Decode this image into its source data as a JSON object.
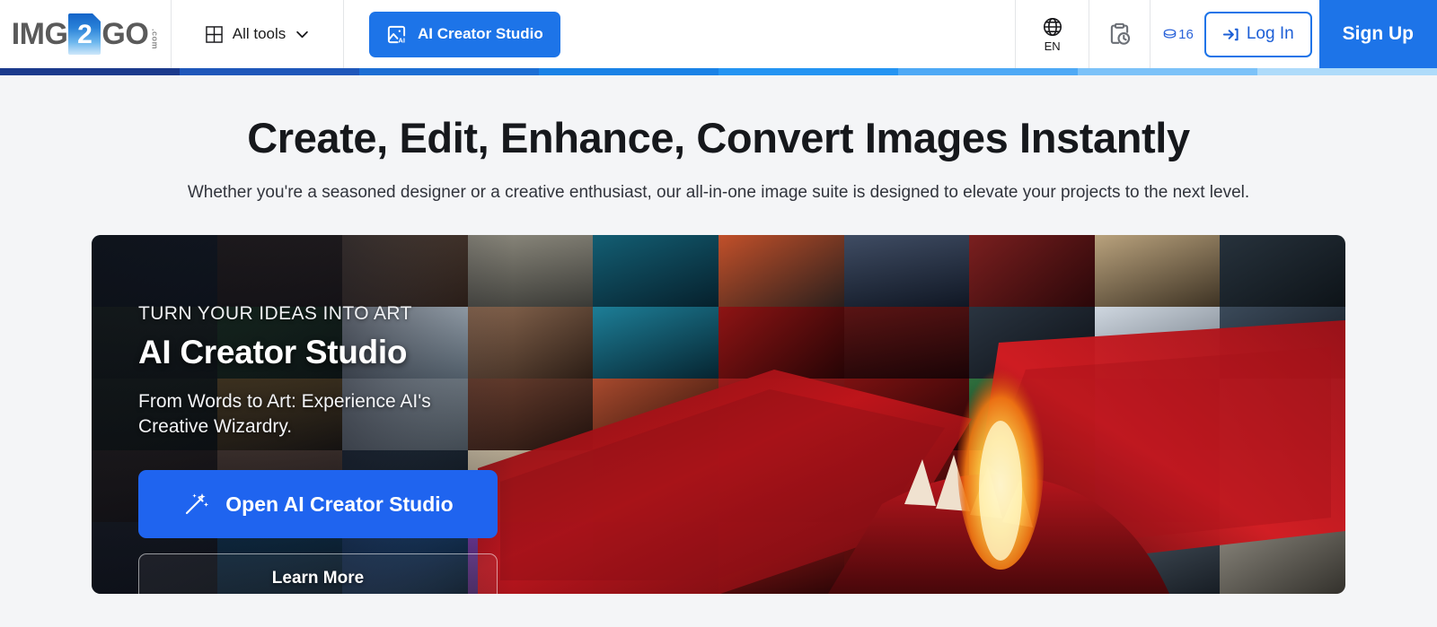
{
  "header": {
    "logo": {
      "left_text": "IMG",
      "badge_text": "2",
      "right_text": "GO",
      "tld_text": ".com"
    },
    "all_tools_label": "All tools",
    "ai_studio_button_label": "AI Creator Studio",
    "language_code": "EN",
    "credits_count": "16",
    "login_label": "Log In",
    "signup_label": "Sign Up",
    "icons": {
      "grid": "grid-icon",
      "chevron": "chevron-down-icon",
      "ai_image": "ai-image-icon",
      "globe": "globe-icon",
      "history": "clipboard-clock-icon",
      "coin": "credit-coin-icon",
      "login_arrow": "login-arrow-icon"
    },
    "accent_color": "#1d74e8",
    "gradient_strip": [
      "#1b3a8c",
      "#1f57ba",
      "#1c6ed4",
      "#1a82e6",
      "#2494f2",
      "#4ea9f5",
      "#7cc2f8",
      "#aedbfa"
    ]
  },
  "hero": {
    "title": "Create, Edit, Enhance, Convert Images Instantly",
    "subtitle": "Whether you're a seasoned designer or a creative enthusiast, our all-in-one image suite is designed to elevate your projects to the next level."
  },
  "banner": {
    "kicker": "TURN YOUR IDEAS INTO ART",
    "heading": "AI Creator Studio",
    "description": "From Words to Art: Experience AI's Creative Wizardry.",
    "primary_button_label": "Open AI Creator Studio",
    "secondary_button_label": "Learn More",
    "primary_button_color": "#1f64ef",
    "wand_icon": "magic-wand-icon"
  }
}
